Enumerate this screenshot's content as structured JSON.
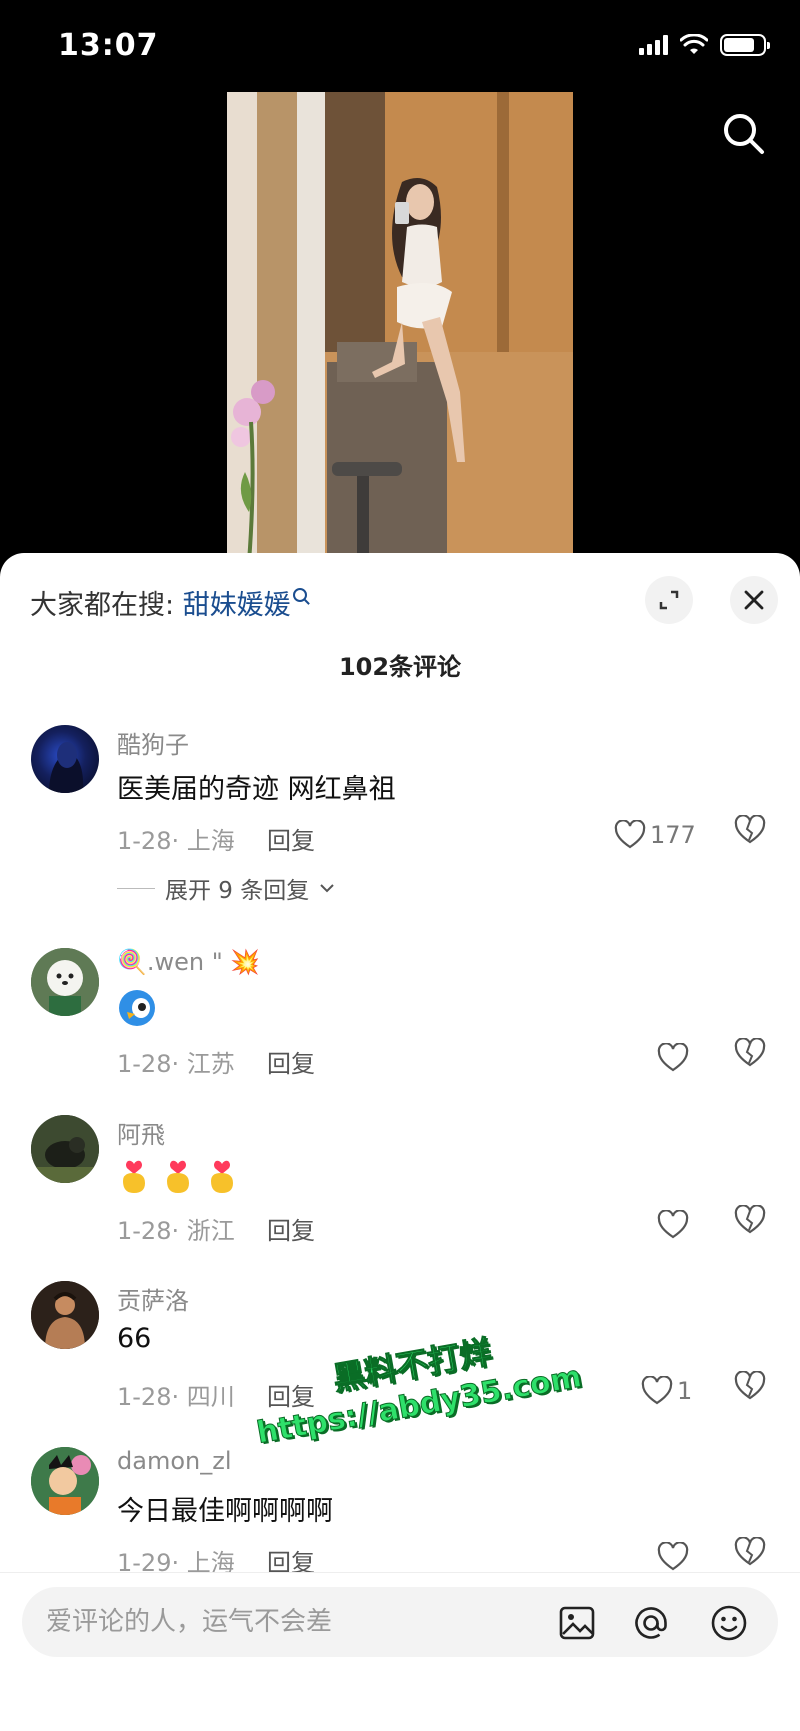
{
  "status_bar": {
    "time": "13:07"
  },
  "video": {
    "search_icon": "search-icon"
  },
  "sheet": {
    "hot_search_label": "大家都在搜:",
    "hot_search_keyword": "甜妹媛媛",
    "expand_icon": "expand-icon",
    "close_icon": "close-icon",
    "comment_count": "102条评论"
  },
  "comments": [
    {
      "name": "酷狗子",
      "text": "医美届的奇迹 网红鼻祖",
      "meta": "1-28· 上海",
      "reply": "回复",
      "likes": "177",
      "expand_replies": "展开 9 条回复"
    },
    {
      "name": "🍭.wen  \" 💥",
      "text": "",
      "emoji": "emoji-bird",
      "meta": "1-28· 江苏",
      "reply": "回复",
      "likes": ""
    },
    {
      "name": "阿飛",
      "text": "",
      "emoji": "emoji-finger-heart x3",
      "meta": "1-28· 浙江",
      "reply": "回复",
      "likes": ""
    },
    {
      "name": "贡萨洛",
      "text": "66",
      "meta": "1-28· 四川",
      "reply": "回复",
      "likes": "1"
    },
    {
      "name": "damon_zl",
      "text": "今日最佳啊啊啊啊",
      "meta": "1-29· 上海",
      "reply": "回复",
      "likes": ""
    }
  ],
  "watermark": {
    "line1": "黑料不打烊",
    "line2": "https://abdy35.com"
  },
  "input": {
    "placeholder": "爱评论的人，运气不会差"
  },
  "colors": {
    "keyword": "#1a4d8f",
    "sheet_bg": "#ffffff",
    "page_bg": "#000000"
  }
}
